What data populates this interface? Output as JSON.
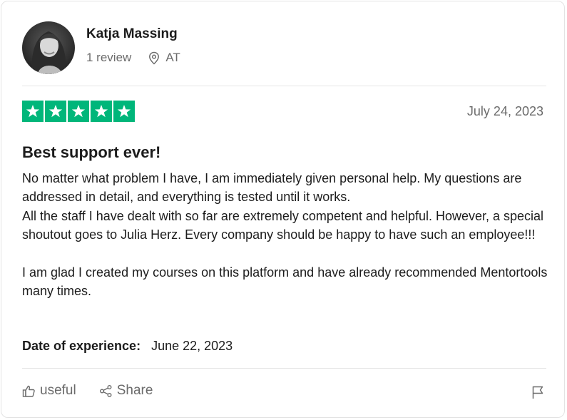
{
  "reviewer": {
    "name": "Katja Massing",
    "review_count": "1 review",
    "country": "AT"
  },
  "review": {
    "rating": 5,
    "rating_max": 5,
    "date": "July 24, 2023",
    "title": "Best support ever!",
    "paragraphs": [
      "No matter what problem I have, I am immediately given personal help. My questions are addressed in detail, and everything is tested until it works.\nAll the staff I have dealt with so far are extremely competent and helpful. However, a special shoutout goes to Julia Herz. Every company should be happy to have such an employee!!!",
      "I am glad I created my courses on this platform and have already recommended Mentortools many times."
    ],
    "experience_label": "Date of experience:",
    "experience_date": "June 22, 2023"
  },
  "actions": {
    "useful_label": "useful",
    "share_label": "Share",
    "useful_icon": "thumbs-up-icon",
    "share_icon": "share-icon",
    "flag_icon": "flag-icon"
  },
  "colors": {
    "star_green": "#00b67a",
    "muted_text": "#6b6b6b"
  }
}
